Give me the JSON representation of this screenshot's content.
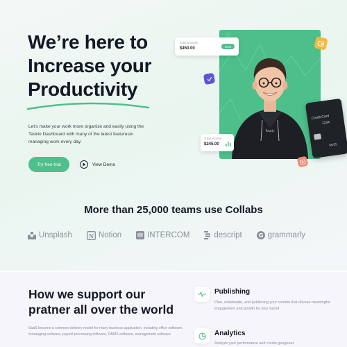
{
  "hero": {
    "title_line1": "We’re here to",
    "title_line2": "Increase your",
    "title_line3": "Productivity",
    "description": "Let's make your work more organize and easily using the Taskio Dashboard with many of the latest featuresin managing work every day.",
    "primary_button": "Try free trial",
    "secondary_button": "View Demo",
    "accent_color": "#4fbf8b"
  },
  "floating_cards": {
    "total_amount_label": "Total amount",
    "total_amount_value": "$450.00",
    "send_label": "Send",
    "total_income_label": "Total income",
    "total_income_value": "$245.00"
  },
  "credit_card": {
    "label": "Credit Card",
    "number_fragment": "1234",
    "expiry": "09/25"
  },
  "teams": {
    "heading": "More than 25,000 teams use Collabs",
    "logos": [
      "Unsplash",
      "Notion",
      "INTERCOM",
      "descript",
      "grammarly"
    ]
  },
  "support": {
    "title_line1": "How we support our",
    "title_line2": "pratner all over the world",
    "description": "SaaS become a common delivery model for many business application, including office software, messaging software, payroll processing software, DBMS software, management software",
    "features": [
      {
        "icon": "pulse-icon",
        "title": "Publishing",
        "description": "Plan, collaborate, and publishing your contetn that drivees meaningful engagement and growth for your barnd"
      },
      {
        "icon": "pie-chart-icon",
        "title": "Analytics",
        "description": "Analyze your performance and create goegeous"
      }
    ]
  }
}
